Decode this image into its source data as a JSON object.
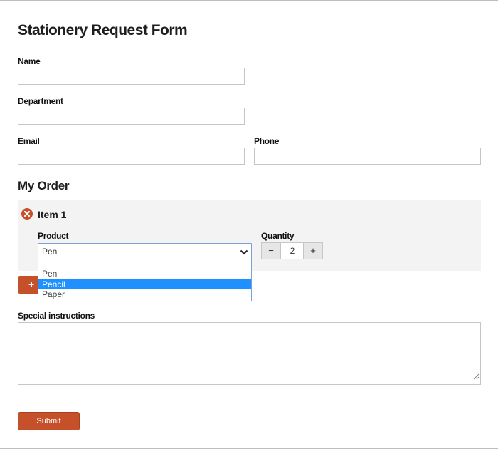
{
  "form": {
    "title": "Stationery Request Form",
    "fields": {
      "name_label": "Name",
      "name_value": "",
      "department_label": "Department",
      "department_value": "",
      "email_label": "Email",
      "email_value": "",
      "phone_label": "Phone",
      "phone_value": ""
    }
  },
  "order": {
    "heading": "My Order",
    "item": {
      "title": "Item 1",
      "product_label": "Product",
      "product_selected": "Pen",
      "quantity_label": "Quantity",
      "quantity_value": "2",
      "minus": "−",
      "plus": "+"
    },
    "dropdown_options": [
      "Pen",
      "Pencil",
      "Paper"
    ],
    "highlighted_option": "Pencil",
    "add_icon": "+"
  },
  "instructions": {
    "label": "Special instructions",
    "value": ""
  },
  "submit_label": "Submit",
  "colors": {
    "accent": "#c5502a",
    "highlight": "#1e90ff",
    "panel": "#f3f3f3"
  }
}
